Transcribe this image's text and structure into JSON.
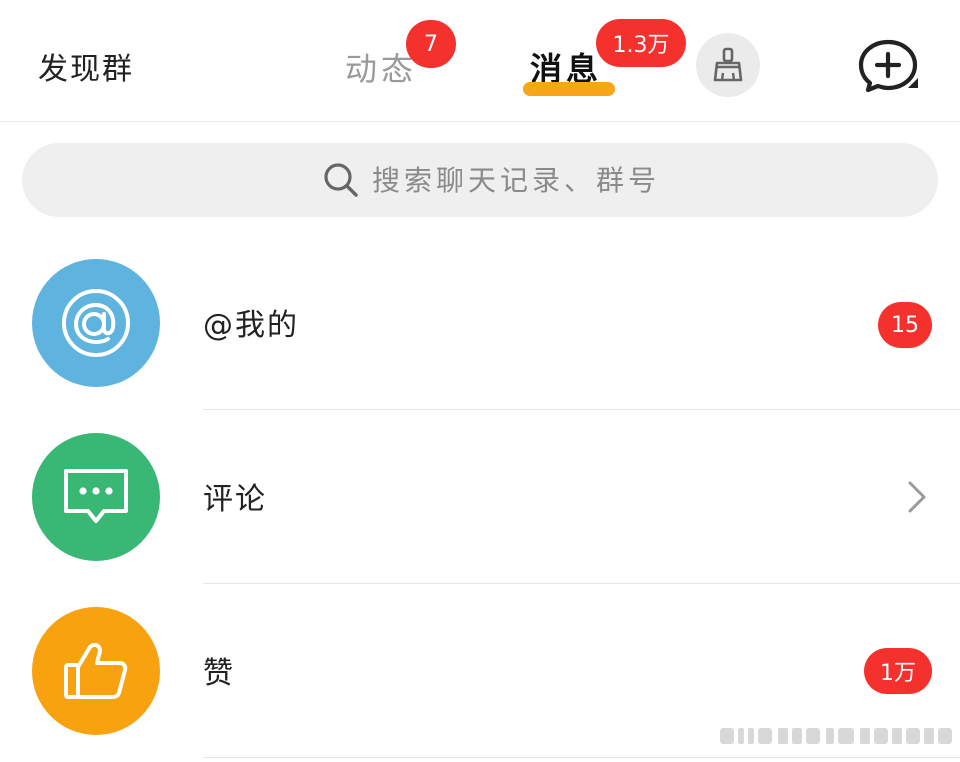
{
  "header": {
    "discover_label": "发现群",
    "tabs": [
      {
        "label": "动态",
        "badge": "7",
        "active": false
      },
      {
        "label": "消息",
        "badge": "1.3万",
        "active": true
      }
    ],
    "clean_icon": "broom-icon",
    "add_icon": "add-chat-icon"
  },
  "search": {
    "placeholder": "搜索聊天记录、群号",
    "value": ""
  },
  "list": [
    {
      "label": "@我的",
      "icon": "at-icon",
      "avatar_color": "#5eb4de",
      "badge": "15"
    },
    {
      "label": "评论",
      "icon": "comment-icon",
      "avatar_color": "#38b874",
      "badge": ""
    },
    {
      "label": "赞",
      "icon": "thumbs-up-icon",
      "avatar_color": "#f9a20f",
      "badge": "1万"
    }
  ],
  "colors": {
    "accent": "#f9a51a",
    "badge": "#f5312e"
  }
}
